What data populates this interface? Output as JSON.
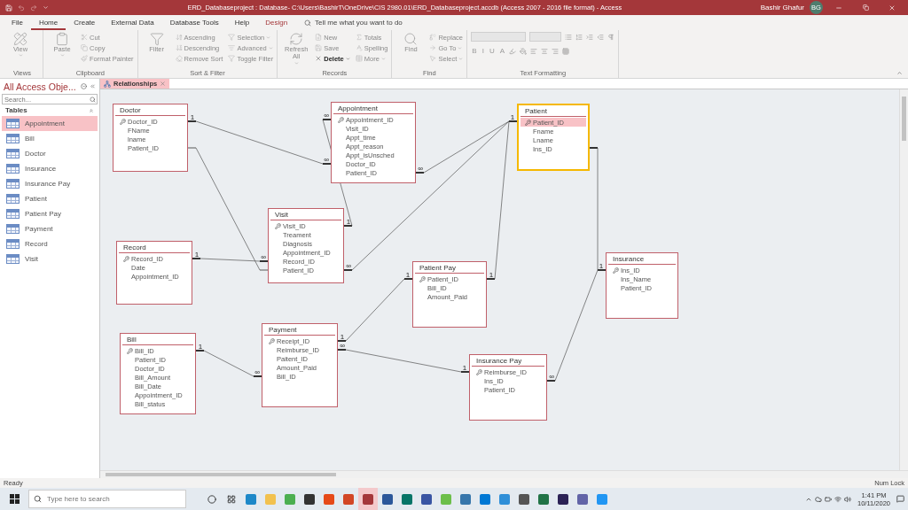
{
  "title_bar": {
    "title": "ERD_Databaseproject : Database- C:\\Users\\BashirT\\OneDrive\\CIS 2980.01\\ERD_Databaseproject.accdb (Access 2007 - 2016 file format)  -  Access",
    "user": "Bashir Ghafur",
    "avatar": "BG"
  },
  "menu_tabs": [
    {
      "label": "File",
      "selected": false,
      "contextual": false
    },
    {
      "label": "Home",
      "selected": true,
      "contextual": false
    },
    {
      "label": "Create",
      "selected": false,
      "contextual": false
    },
    {
      "label": "External Data",
      "selected": false,
      "contextual": false
    },
    {
      "label": "Database Tools",
      "selected": false,
      "contextual": false
    },
    {
      "label": "Help",
      "selected": false,
      "contextual": false
    },
    {
      "label": "Design",
      "selected": false,
      "contextual": true
    }
  ],
  "tell_me": {
    "placeholder": "Tell me what you want to do"
  },
  "ribbon": {
    "groups": [
      {
        "label": "Views",
        "kind": "buttons",
        "buttons": [
          {
            "label": "View",
            "kind": "large",
            "disabled": true,
            "dropdown": true
          }
        ]
      },
      {
        "label": "Clipboard",
        "kind": "buttons",
        "buttons": [
          {
            "label": "Paste",
            "kind": "large",
            "disabled": true,
            "dropdown": true
          },
          {
            "label": "Cut",
            "kind": "small",
            "disabled": true,
            "dropdown": false
          },
          {
            "label": "Copy",
            "kind": "small",
            "disabled": true,
            "dropdown": false
          },
          {
            "label": "Format Painter",
            "kind": "small",
            "disabled": true,
            "dropdown": false
          }
        ]
      },
      {
        "label": "Sort & Filter",
        "kind": "buttons",
        "buttons": [
          {
            "label": "Filter",
            "kind": "large",
            "disabled": true,
            "dropdown": false
          },
          {
            "label": "Ascending",
            "kind": "small",
            "disabled": true,
            "dropdown": false
          },
          {
            "label": "Descending",
            "kind": "small",
            "disabled": true,
            "dropdown": false
          },
          {
            "label": "Remove Sort",
            "kind": "small",
            "disabled": true,
            "dropdown": false
          },
          {
            "label": "Selection",
            "kind": "small",
            "disabled": true,
            "dropdown": true
          },
          {
            "label": "Advanced",
            "kind": "small",
            "disabled": true,
            "dropdown": true
          },
          {
            "label": "Toggle Filter",
            "kind": "small",
            "disabled": true,
            "dropdown": false
          }
        ]
      },
      {
        "label": "Records",
        "kind": "buttons",
        "buttons": [
          {
            "label": "Refresh All",
            "kind": "large",
            "disabled": true,
            "dropdown": true
          },
          {
            "label": "New",
            "kind": "small",
            "disabled": true,
            "dropdown": false
          },
          {
            "label": "Save",
            "kind": "small",
            "disabled": true,
            "dropdown": false
          },
          {
            "label": "Delete",
            "kind": "small",
            "disabled": false,
            "dropdown": true
          },
          {
            "label": "Totals",
            "kind": "small",
            "disabled": true,
            "dropdown": false
          },
          {
            "label": "Spelling",
            "kind": "small",
            "disabled": true,
            "dropdown": false
          },
          {
            "label": "More",
            "kind": "small",
            "disabled": true,
            "dropdown": true
          }
        ]
      },
      {
        "label": "Find",
        "kind": "buttons",
        "buttons": [
          {
            "label": "Find",
            "kind": "large",
            "disabled": true,
            "dropdown": false
          },
          {
            "label": "Replace",
            "kind": "small",
            "disabled": true,
            "dropdown": false
          },
          {
            "label": "Go To",
            "kind": "small",
            "disabled": true,
            "dropdown": true
          },
          {
            "label": "Select",
            "kind": "small",
            "disabled": true,
            "dropdown": true
          }
        ]
      },
      {
        "label": "Text Formatting",
        "kind": "formatting",
        "glyphs": [
          {
            "label": "B",
            "disabled": true
          },
          {
            "label": "I",
            "disabled": true
          },
          {
            "label": "U",
            "disabled": true
          },
          {
            "label": "A",
            "disabled": true
          }
        ]
      }
    ]
  },
  "nav_pane": {
    "title": "All Access Obje...",
    "search": {
      "placeholder": "Search..."
    },
    "group": "Tables",
    "items": [
      {
        "label": "Appointment",
        "selected": true
      },
      {
        "label": "Bill",
        "selected": false
      },
      {
        "label": "Doctor",
        "selected": false
      },
      {
        "label": "Insurance",
        "selected": false
      },
      {
        "label": "Insurance Pay",
        "selected": false
      },
      {
        "label": "Patient",
        "selected": false
      },
      {
        "label": "Patient Pay",
        "selected": false
      },
      {
        "label": "Payment",
        "selected": false
      },
      {
        "label": "Record",
        "selected": false
      },
      {
        "label": "Visit",
        "selected": false
      }
    ]
  },
  "document_tab": {
    "label": "Relationships",
    "selected": true
  },
  "tables": [
    {
      "name": "Doctor",
      "selected": false,
      "fields": [
        {
          "name": "Doctor_ID",
          "key": true,
          "selected": false
        },
        {
          "name": "FName",
          "key": false,
          "selected": false
        },
        {
          "name": "lname",
          "key": false,
          "selected": false
        },
        {
          "name": "Patient_ID",
          "key": false,
          "selected": false
        }
      ]
    },
    {
      "name": "Appointment",
      "selected": false,
      "fields": [
        {
          "name": "Appointment_ID",
          "key": true,
          "selected": false
        },
        {
          "name": "Visit_ID",
          "key": false,
          "selected": false
        },
        {
          "name": "Appt_time",
          "key": false,
          "selected": false
        },
        {
          "name": "Appt_reason",
          "key": false,
          "selected": false
        },
        {
          "name": "Appt_isUnsched",
          "key": false,
          "selected": false
        },
        {
          "name": "Doctor_ID",
          "key": false,
          "selected": false
        },
        {
          "name": "Patient_ID",
          "key": false,
          "selected": false
        }
      ]
    },
    {
      "name": "Patient",
      "selected": true,
      "fields": [
        {
          "name": "Patient_ID",
          "key": true,
          "selected": true
        },
        {
          "name": "Fname",
          "key": false,
          "selected": false
        },
        {
          "name": "Lname",
          "key": false,
          "selected": false
        },
        {
          "name": "Ins_ID",
          "key": false,
          "selected": false
        }
      ]
    },
    {
      "name": "Visit",
      "selected": false,
      "fields": [
        {
          "name": "Visit_ID",
          "key": true,
          "selected": false
        },
        {
          "name": "Treament",
          "key": false,
          "selected": false
        },
        {
          "name": "Diagnosis",
          "key": false,
          "selected": false
        },
        {
          "name": "Appointment_ID",
          "key": false,
          "selected": false
        },
        {
          "name": "Record_ID",
          "key": false,
          "selected": false
        },
        {
          "name": "Patient_ID",
          "key": false,
          "selected": false
        }
      ]
    },
    {
      "name": "Record",
      "selected": false,
      "fields": [
        {
          "name": "Record_ID",
          "key": true,
          "selected": false
        },
        {
          "name": "Date",
          "key": false,
          "selected": false
        },
        {
          "name": "Appointment_ID",
          "key": false,
          "selected": false
        }
      ]
    },
    {
      "name": "Patient Pay",
      "selected": false,
      "fields": [
        {
          "name": "Patient_ID",
          "key": true,
          "selected": false
        },
        {
          "name": "Bill_ID",
          "key": false,
          "selected": false
        },
        {
          "name": "Amount_Paid",
          "key": false,
          "selected": false
        }
      ]
    },
    {
      "name": "Insurance",
      "selected": false,
      "fields": [
        {
          "name": "Ins_ID",
          "key": true,
          "selected": false
        },
        {
          "name": "Ins_Name",
          "key": false,
          "selected": false
        },
        {
          "name": "Patient_ID",
          "key": false,
          "selected": false
        }
      ]
    },
    {
      "name": "Bill",
      "selected": false,
      "fields": [
        {
          "name": "Bill_ID",
          "key": true,
          "selected": false
        },
        {
          "name": "Patient_ID",
          "key": false,
          "selected": false
        },
        {
          "name": "Doctor_ID",
          "key": false,
          "selected": false
        },
        {
          "name": "Bill_Amount",
          "key": false,
          "selected": false
        },
        {
          "name": "Bill_Date",
          "key": false,
          "selected": false
        },
        {
          "name": "Appointment_ID",
          "key": false,
          "selected": false
        },
        {
          "name": "Bill_status",
          "key": false,
          "selected": false
        }
      ]
    },
    {
      "name": "Payment",
      "selected": false,
      "fields": [
        {
          "name": "Receipt_ID",
          "key": true,
          "selected": false
        },
        {
          "name": "Reimburse_ID",
          "key": false,
          "selected": false
        },
        {
          "name": "Paitent_ID",
          "key": false,
          "selected": false
        },
        {
          "name": "Amount_Paid",
          "key": false,
          "selected": false
        },
        {
          "name": "Bill_ID",
          "key": false,
          "selected": false
        }
      ]
    },
    {
      "name": "Insurance Pay",
      "selected": false,
      "fields": [
        {
          "name": "Reimburse_ID",
          "key": true,
          "selected": false
        },
        {
          "name": "Ins_ID",
          "key": false,
          "selected": false
        },
        {
          "name": "Patient_ID",
          "key": false,
          "selected": false
        }
      ]
    }
  ],
  "relationships": [
    {
      "enforced": true,
      "end_a": "1",
      "end_b": "∞"
    },
    {
      "enforced": false
    },
    {
      "enforced": true,
      "end_a": "∞",
      "end_b": "1"
    },
    {
      "enforced": true,
      "end_a": "∞"
    },
    {
      "enforced": true,
      "end_a": "∞"
    },
    {
      "enforced": true,
      "end_a": "1",
      "end_b": "1"
    },
    {
      "enforced": true,
      "end_a": "1",
      "end_b": "∞"
    },
    {
      "enforced": true
    },
    {
      "enforced": true,
      "end_a": "∞",
      "end_b": "1"
    },
    {
      "enforced": true,
      "end_a": "1",
      "end_b": "∞"
    },
    {
      "enforced": true,
      "end_a": "1",
      "end_b": "1"
    },
    {
      "enforced": true,
      "end_a": "∞",
      "end_b": "1"
    }
  ],
  "status_bar": {
    "left": "Ready",
    "right": "Num Lock"
  },
  "taskbar": {
    "search": {
      "placeholder": "Type here to search"
    },
    "apps": [
      {
        "color": "#1e88c8",
        "selected": false
      },
      {
        "color": "#f2c14e",
        "selected": false
      },
      {
        "color": "#4caf50",
        "selected": false
      },
      {
        "color": "#333333",
        "selected": false
      },
      {
        "color": "#e64a19",
        "selected": false
      },
      {
        "color": "#d24726",
        "selected": false
      },
      {
        "color": "#a4373a",
        "selected": true
      },
      {
        "color": "#2b579a",
        "selected": false
      },
      {
        "color": "#077568",
        "selected": false
      },
      {
        "color": "#3955a3",
        "selected": false
      },
      {
        "color": "#6cbf4a",
        "selected": false
      },
      {
        "color": "#3776ab",
        "selected": false
      },
      {
        "color": "#0078d4",
        "selected": false
      },
      {
        "color": "#2f8fd8",
        "selected": false
      },
      {
        "color": "#555555",
        "selected": false
      },
      {
        "color": "#217346",
        "selected": false
      },
      {
        "color": "#2c2255",
        "selected": false
      },
      {
        "color": "#6264a7",
        "selected": false
      },
      {
        "color": "#2196f3",
        "selected": false
      }
    ],
    "time": "1:41 PM",
    "date": "10/11/2020"
  }
}
